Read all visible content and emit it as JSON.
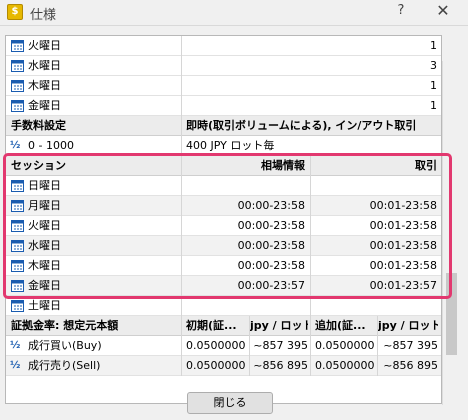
{
  "window": {
    "title": "仕様",
    "help": "?",
    "close": "✕"
  },
  "top_rows": [
    {
      "label": "火曜日",
      "value": "1"
    },
    {
      "label": "水曜日",
      "value": "3"
    },
    {
      "label": "木曜日",
      "value": "1"
    },
    {
      "label": "金曜日",
      "value": "1"
    }
  ],
  "fee": {
    "header_left": "手数料設定",
    "header_right": "即時(取引ボリュームによる), イン/アウト取引",
    "row_label": "0 - 1000",
    "row_value": "400 JPY ロット毎"
  },
  "sessions": {
    "header": {
      "session": "セッション",
      "quotes": "相場情報",
      "trade": "取引"
    },
    "rows": [
      {
        "day": "日曜日",
        "quotes": "",
        "trade": ""
      },
      {
        "day": "月曜日",
        "quotes": "00:00-23:58",
        "trade": "00:01-23:58"
      },
      {
        "day": "火曜日",
        "quotes": "00:00-23:58",
        "trade": "00:01-23:58"
      },
      {
        "day": "水曜日",
        "quotes": "00:00-23:58",
        "trade": "00:01-23:58"
      },
      {
        "day": "木曜日",
        "quotes": "00:00-23:58",
        "trade": "00:01-23:58"
      },
      {
        "day": "金曜日",
        "quotes": "00:00-23:57",
        "trade": "00:01-23:57"
      },
      {
        "day": "土曜日",
        "quotes": "",
        "trade": ""
      }
    ]
  },
  "margin": {
    "header": {
      "c1": "証拠金率: 想定元本額",
      "c2": "初期(証...",
      "c3": "jpy / ロット",
      "c4": "追加(証...",
      "c5": "jpy / ロット"
    },
    "rows": [
      {
        "label": "成行買い(Buy)",
        "v1": "0.0500000",
        "v2": "~857 395",
        "v3": "0.0500000",
        "v4": "~857 395"
      },
      {
        "label": "成行売り(Sell)",
        "v1": "0.0500000",
        "v2": "~856 895",
        "v3": "0.0500000",
        "v4": "~856 895"
      }
    ]
  },
  "buttons": {
    "close": "閉じる"
  },
  "colors": {
    "highlight": "#e2386f",
    "icon": "#1a5cb0"
  }
}
